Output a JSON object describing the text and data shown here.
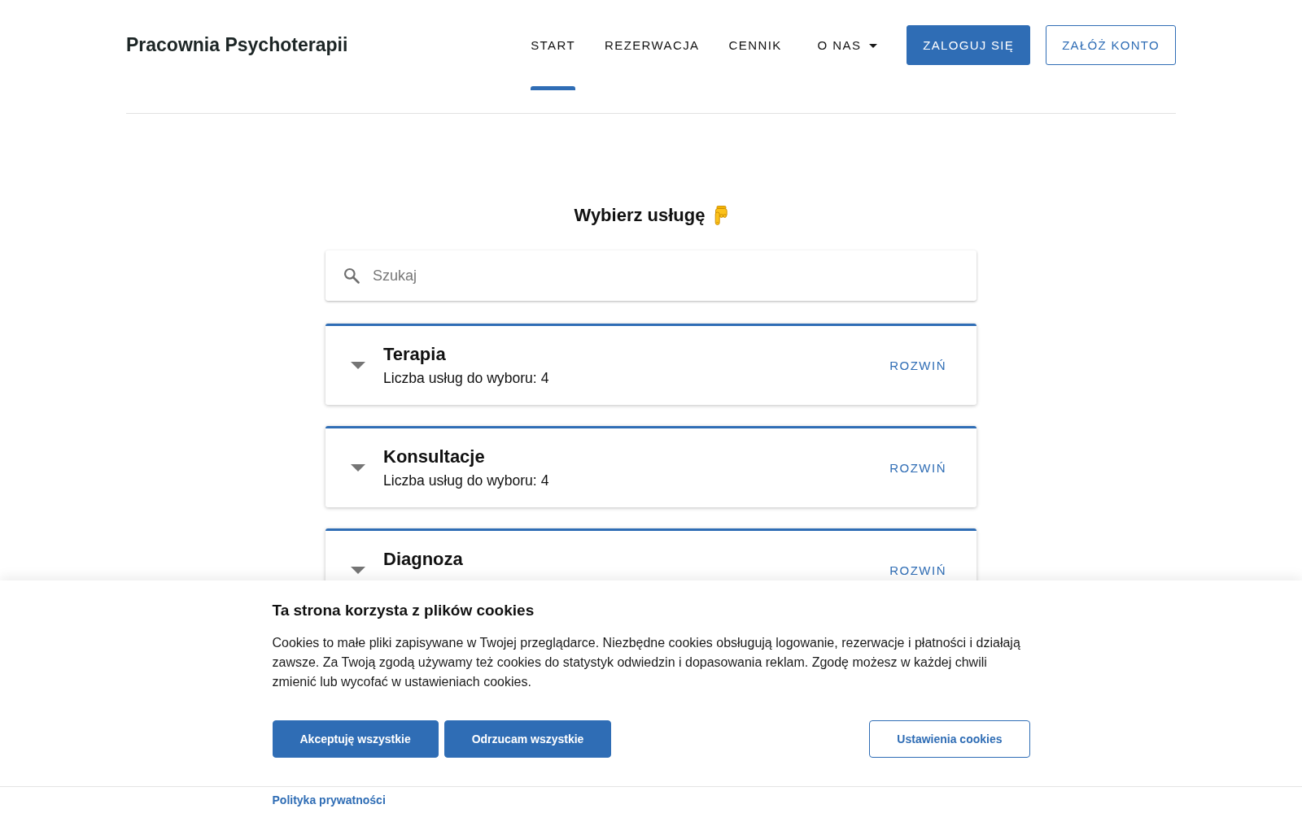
{
  "header": {
    "logo": "Pracownia Psychoterapii",
    "nav": [
      {
        "label": "START",
        "kind": "link",
        "selected": true
      },
      {
        "label": "REZERWACJA",
        "kind": "link",
        "selected": false
      },
      {
        "label": "CENNIK",
        "kind": "link",
        "selected": false
      },
      {
        "label": "O NAS",
        "kind": "dropdown",
        "selected": false
      }
    ],
    "buttons": [
      {
        "label": "ZALOGUJ SIĘ",
        "kind": "primary"
      },
      {
        "label": "ZAŁÓŻ KONTO",
        "kind": "outline"
      }
    ]
  },
  "services": {
    "title": "Wybierz usługę",
    "search": {
      "placeholder": "Szukaj"
    },
    "categories": [
      {
        "name": "Terapia",
        "subtitle": "Liczba usług do wyboru: 4",
        "action": "ROZWIŃ",
        "expanded": false
      },
      {
        "name": "Konsultacje",
        "subtitle": "Liczba usług do wyboru: 4",
        "action": "ROZWIŃ",
        "expanded": false
      },
      {
        "name": "Diagnoza",
        "action": "ROZWIŃ",
        "expanded": false
      }
    ]
  },
  "cookie_banner": {
    "title": "Ta strona korzysta z plików cookies",
    "text": "Cookies to małe pliki zapisywane w Twojej przeglądarce. Niezbędne cookies obsługują logowanie, rezerwacje i płatności i działają zawsze. Za Twoją zgodą używamy też cookies do statystyk odwiedzin i dopasowania reklam. Zgodę możesz w każdej chwili zmienić lub wycofać w ustawieniach cookies.",
    "buttons": [
      {
        "label": "Akceptuję wszystkie",
        "kind": "primary"
      },
      {
        "label": "Odrzucam wszystkie",
        "kind": "primary"
      },
      {
        "label": "Ustawienia cookies",
        "kind": "outline"
      }
    ],
    "link": "Polityka prywatności"
  }
}
